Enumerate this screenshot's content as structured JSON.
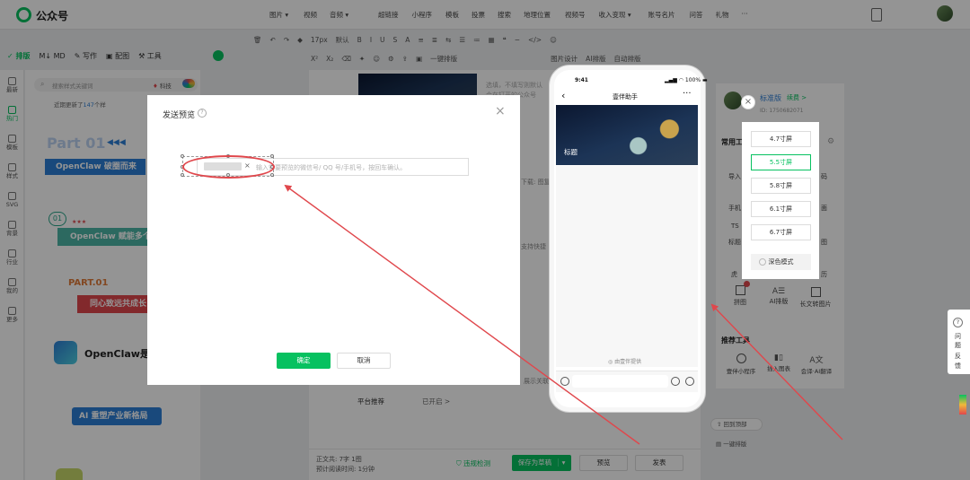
{
  "app": {
    "title": "公众号"
  },
  "top_nav": [
    {
      "label": "图片",
      "caret": "▾"
    },
    {
      "label": "视频",
      "caret": ""
    },
    {
      "label": "音频",
      "caret": "▾"
    },
    {
      "label": "超链接",
      "caret": ""
    },
    {
      "label": "小程序",
      "caret": ""
    },
    {
      "label": "模板",
      "caret": ""
    },
    {
      "label": "投票",
      "caret": ""
    },
    {
      "label": "搜索",
      "caret": ""
    },
    {
      "label": "地理位置",
      "caret": ""
    },
    {
      "label": "视频号",
      "caret": ""
    },
    {
      "label": "收入变现",
      "caret": "▾"
    },
    {
      "label": "账号名片",
      "caret": ""
    },
    {
      "label": "问答",
      "caret": ""
    },
    {
      "label": "礼物",
      "caret": ""
    },
    {
      "label": "···",
      "caret": ""
    }
  ],
  "format_toolbar": {
    "font_size": "17px",
    "default_label": "默认",
    "tools": [
      "B",
      "I",
      "U",
      "S",
      "A",
      "≡",
      "≣",
      "⇆"
    ],
    "row2": [
      "一键排版",
      "图片设计",
      "AI排版",
      "自动排版"
    ]
  },
  "left_tabs": [
    {
      "label": "排版",
      "active": true
    },
    {
      "label": "MD",
      "active": false
    },
    {
      "label": "写作",
      "active": false
    },
    {
      "label": "配图",
      "active": false
    },
    {
      "label": "工具",
      "active": false
    }
  ],
  "side_nav": [
    {
      "label": "最新",
      "active": false
    },
    {
      "label": "热门",
      "active": true
    },
    {
      "label": "模板",
      "active": false
    },
    {
      "label": "样式",
      "active": false
    },
    {
      "label": "SVG",
      "active": false
    },
    {
      "label": "背景",
      "active": false
    },
    {
      "label": "行业",
      "active": false
    },
    {
      "label": "我的",
      "active": false
    },
    {
      "label": "更多",
      "active": false
    }
  ],
  "template_panel": {
    "search_placeholder": "搜索样式关键词",
    "filter_label": "科技",
    "recent_text": "近期更新了",
    "recent_count": "147",
    "recent_suffix": "个样",
    "cards": [
      {
        "label": "Part 01"
      },
      {
        "label": "OpenClaw 破圈而来"
      },
      {
        "label": "OpenClaw 赋能多个"
      },
      {
        "label": "PART.01"
      },
      {
        "label": "同心致远共成长"
      },
      {
        "label": "OpenClaw是"
      },
      {
        "label": "AI 重塑产业新格局"
      }
    ]
  },
  "editor": {
    "hint_line1": "选填，不填写则默认",
    "hint_line2": "会在打开的公众号",
    "platform_label": "平台推荐",
    "platform_value": "已开启 >",
    "fragment_1": "下载: 图复",
    "fragment_2": "支持快捷",
    "fragment_3": "展示关联",
    "stats_line1": "正文共: 7字 1图",
    "stats_line2": "预计阅读时间: 1分钟",
    "actions": {
      "originality": "违规检测",
      "save_draft": "保存为草稿",
      "preview": "预览",
      "publish": "发表"
    }
  },
  "right_panel": {
    "account_name": "标准版",
    "account_action": "续费 >",
    "account_id": "ID: 1750682071",
    "common_tools_title": "常用工具",
    "tool_labels": [
      "导入",
      "手机",
      "TS",
      "标题",
      "虎"
    ],
    "right_frag": [
      "码",
      "面",
      "图",
      "历"
    ],
    "bottom_tools": [
      {
        "label": "拼图"
      },
      {
        "label": "AI排版"
      },
      {
        "label": "长文转图片"
      }
    ],
    "recommend_title": "推荐工具",
    "recommend_tools": [
      {
        "label": "壹伴小程序"
      },
      {
        "label": "插入图表"
      },
      {
        "label": "会译·AI翻译"
      }
    ],
    "links": [
      "回到顶部",
      "一键排版"
    ]
  },
  "preview_modal": {
    "title": "发送预览",
    "recipient_placeholder": "输入需要预览的微信号/ QQ 号/手机号，按回车确认。",
    "chip_remove": "×",
    "close": "×",
    "confirm_label": "确定",
    "cancel_label": "取消"
  },
  "phone_preview": {
    "time": "9:41",
    "status": "▂▄▆ ◠ 100% ▬",
    "title": "壹伴助手",
    "cover_text": "标题",
    "footer": "由壹伴提供"
  },
  "screen_size": {
    "options": [
      "4.7寸屏",
      "5.5寸屏",
      "5.8寸屏",
      "6.1寸屏",
      "6.7寸屏"
    ],
    "selected": "5.5寸屏",
    "dark_mode_label": "深色模式"
  },
  "help": {
    "label_chars": [
      "问",
      "题",
      "反",
      "馈"
    ]
  },
  "annotation": {
    "color": "#e0474c"
  },
  "colors": {
    "brand_green": "#07c160",
    "accent_blue": "#2c7ed6",
    "accent_red": "#e0474c"
  }
}
